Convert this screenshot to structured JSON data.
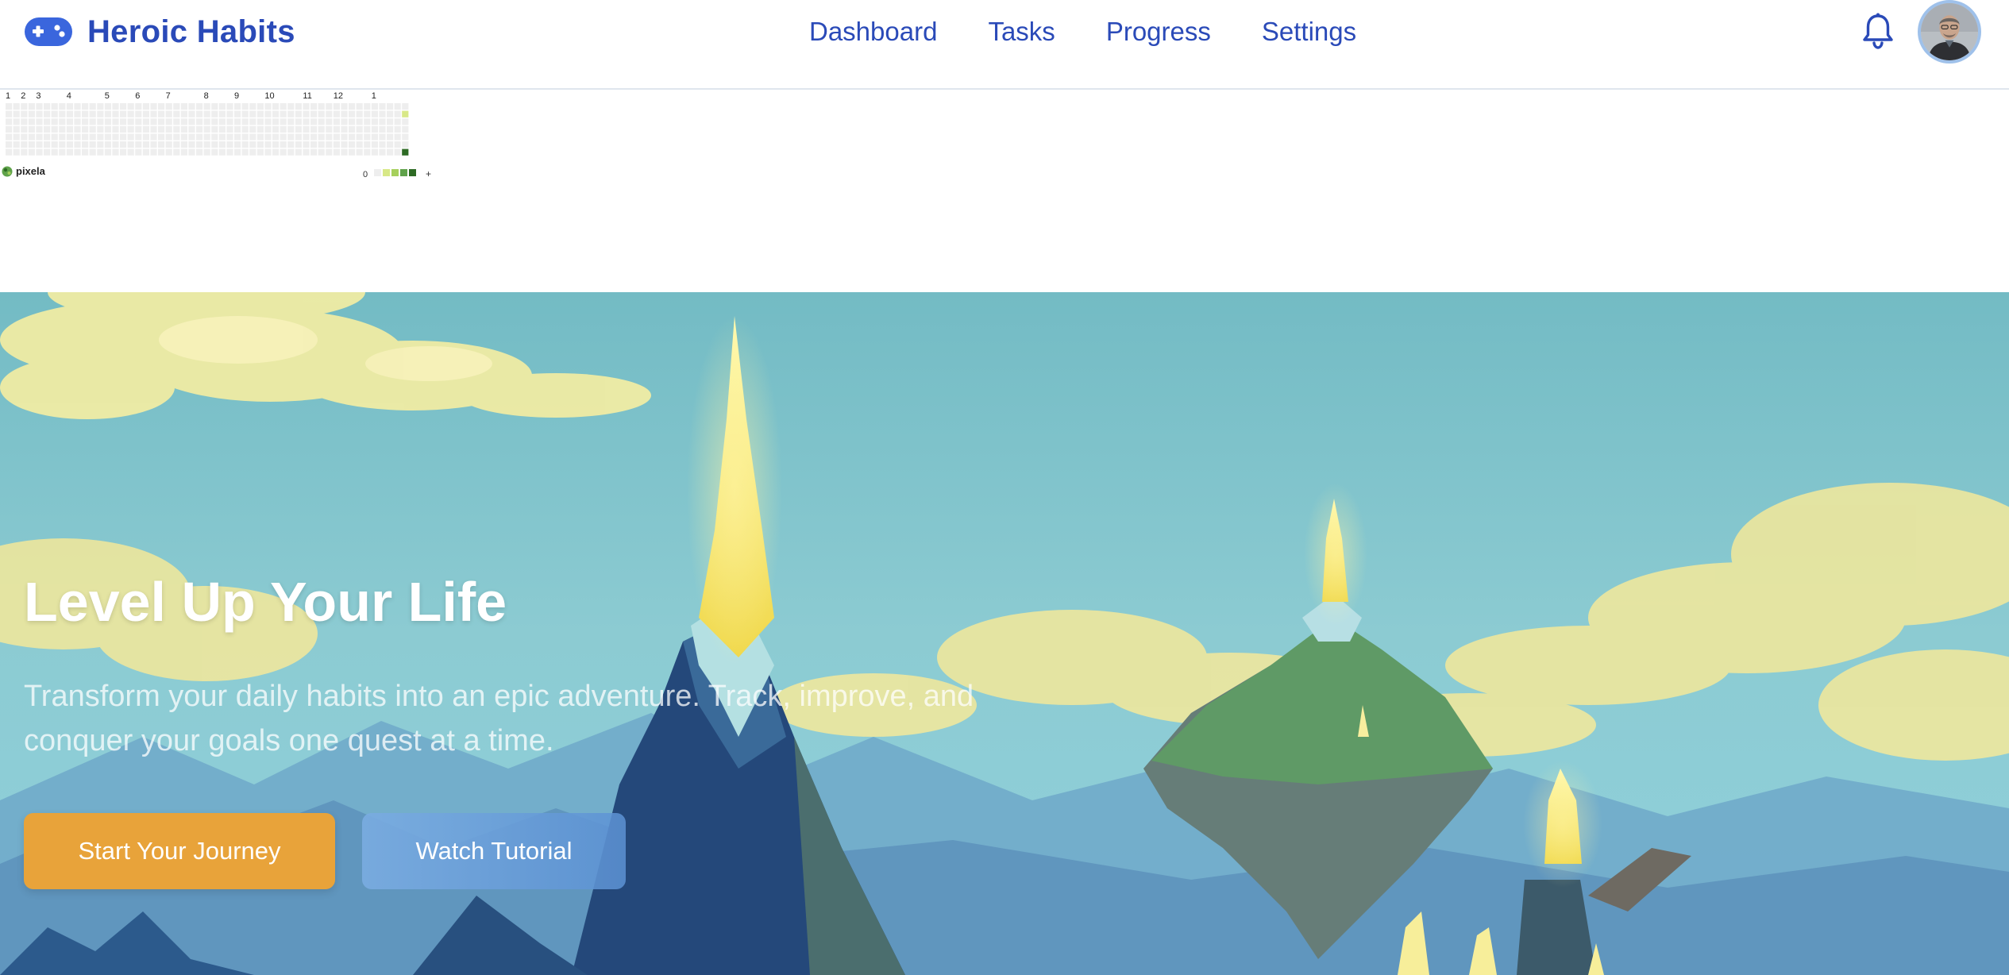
{
  "header": {
    "brand_name": "Heroic Habits",
    "brand_color": "#2a4ab8",
    "logo_icon": "gamepad-icon",
    "nav": [
      {
        "label": "Dashboard"
      },
      {
        "label": "Tasks"
      },
      {
        "label": "Progress"
      },
      {
        "label": "Settings"
      }
    ],
    "notification_icon": "bell-icon",
    "avatar": "user-avatar"
  },
  "pixela_graph": {
    "month_labels": [
      "1",
      "2",
      "3",
      "4",
      "5",
      "6",
      "7",
      "8",
      "9",
      "10",
      "11",
      "12",
      "1"
    ],
    "legend_min": "0",
    "legend_max": "+",
    "legend_colors": [
      "#eeeeee",
      "#d8e887",
      "#a6d05c",
      "#5fa24a",
      "#2e6b25"
    ],
    "brand": "pixela",
    "active_cells": [
      {
        "week": 52,
        "day": 1,
        "level": 1
      },
      {
        "week": 52,
        "day": 6,
        "level": 4
      }
    ]
  },
  "hero": {
    "title": "Level Up Your Life",
    "subtitle": "Transform your daily habits into an epic adventure. Track, improve, and conquer your goals one quest at a time.",
    "primary_button": "Start Your Journey",
    "secondary_button": "Watch Tutorial",
    "primary_color": "#e8a33a",
    "secondary_color": "#7aace1"
  }
}
